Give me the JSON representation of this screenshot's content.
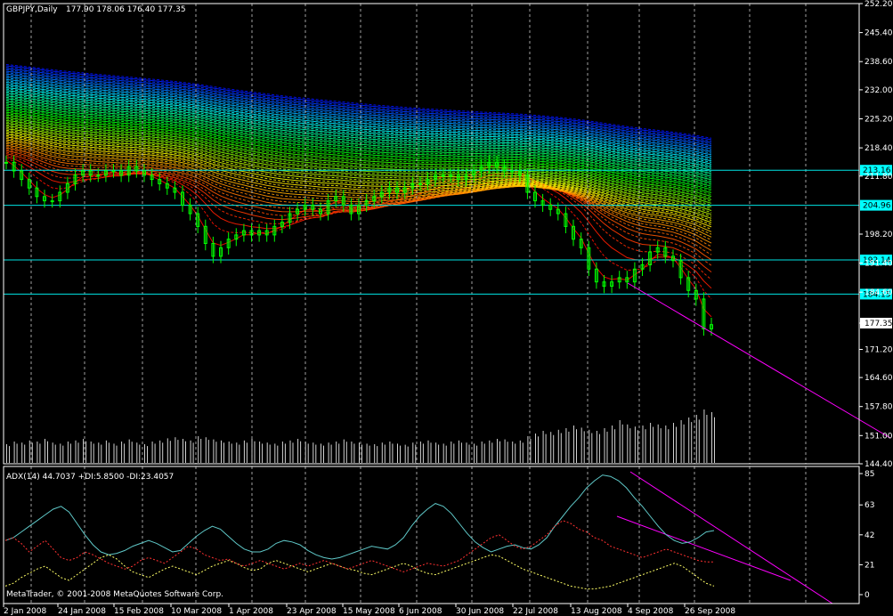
{
  "header": {
    "symbol": "GBPJPY,Daily",
    "ohlc": "177.90 178.06 176.40 177.35"
  },
  "indicator_header": {
    "text": "ADX(14) 44.7037 +DI:5.8500 -DI:23.4057"
  },
  "copyright": "MetaTrader, © 2001-2008 MetaQuotes Software Corp.",
  "colors": {
    "background": "#000000",
    "frame": "#ffffff",
    "grid": "#c8c8c8",
    "candle": "#00ff00",
    "hline": "#00e5e5",
    "trend": "#ff00ff",
    "adx": "#5fc8c8",
    "plus_di": "#ffff66",
    "minus_di": "#ff3030",
    "hline_label_bg": "#00ffff"
  },
  "chart_data": [
    {
      "type": "candlestick",
      "title": "GBPJPY,Daily",
      "x_ticks": [
        "2 Jan 2008",
        "24 Jan 2008",
        "15 Feb 2008",
        "10 Mar 2008",
        "1 Apr 2008",
        "23 Apr 2008",
        "15 May 2008",
        "6 Jun 2008",
        "30 Jun 2008",
        "22 Jul 2008",
        "13 Aug 2008",
        "4 Sep 2008",
        "26 Sep 2008"
      ],
      "y_ticks": [
        "252.20",
        "245.40",
        "238.60",
        "232.00",
        "225.20",
        "218.40",
        "211.80",
        "204.96",
        "198.20",
        "191.40",
        "184.60",
        "177.35",
        "171.20",
        "164.60",
        "157.80",
        "151.00",
        "144.40"
      ],
      "ylim": [
        144.4,
        252.2
      ],
      "last_price": "177.35",
      "horizontal_levels": [
        "213.16",
        "204.96",
        "192.14",
        "184.15"
      ],
      "series": [
        {
          "name": "close",
          "values": [
            215,
            213,
            211,
            209,
            207,
            206,
            206,
            208,
            210,
            212,
            213,
            212,
            212,
            213,
            213,
            212,
            214,
            213,
            212,
            211,
            210,
            209,
            208,
            205,
            203,
            200,
            196,
            193,
            195,
            197,
            198,
            199,
            198,
            199,
            198,
            200,
            201,
            203,
            204,
            205,
            204,
            203,
            206,
            207,
            205,
            203,
            205,
            206,
            207,
            208,
            209,
            208,
            209,
            210,
            210,
            211,
            212,
            212,
            212,
            211,
            212,
            213,
            214,
            215,
            214,
            213,
            213,
            212,
            208,
            206,
            205,
            204,
            203,
            200,
            197,
            195,
            190,
            187,
            186,
            187,
            188,
            187,
            190,
            191,
            194,
            195,
            193,
            192,
            188,
            185,
            183,
            176,
            177
          ]
        },
        {
          "name": "volume",
          "values": [
            0.35,
            0.4,
            0.38,
            0.42,
            0.4,
            0.45,
            0.38,
            0.36,
            0.4,
            0.42,
            0.45,
            0.4,
            0.38,
            0.42,
            0.36,
            0.4,
            0.44,
            0.38,
            0.35,
            0.4,
            0.42,
            0.46,
            0.48,
            0.45,
            0.42,
            0.5,
            0.48,
            0.44,
            0.42,
            0.4,
            0.38,
            0.42,
            0.45,
            0.4,
            0.38,
            0.36,
            0.4,
            0.42,
            0.45,
            0.4,
            0.38,
            0.36,
            0.38,
            0.4,
            0.44,
            0.4,
            0.38,
            0.36,
            0.35,
            0.38,
            0.4,
            0.36,
            0.34,
            0.38,
            0.4,
            0.42,
            0.38,
            0.36,
            0.4,
            0.42,
            0.38,
            0.36,
            0.4,
            0.42,
            0.45,
            0.44,
            0.4,
            0.42,
            0.5,
            0.55,
            0.6,
            0.58,
            0.62,
            0.65,
            0.7,
            0.66,
            0.62,
            0.6,
            0.65,
            0.7,
            0.8,
            0.72,
            0.68,
            0.7,
            0.75,
            0.72,
            0.7,
            0.75,
            0.8,
            0.85,
            0.9,
            1.0,
            0.95
          ]
        }
      ]
    },
    {
      "type": "line",
      "title": "ADX(14) 44.7037 +DI:5.8500 -DI:23.4057",
      "y_ticks": [
        "85",
        "63",
        "42",
        "21",
        "0"
      ],
      "ylim": [
        0,
        85
      ],
      "series": [
        {
          "name": "ADX",
          "values": [
            38,
            40,
            44,
            48,
            52,
            56,
            60,
            62,
            58,
            50,
            42,
            35,
            30,
            28,
            29,
            31,
            34,
            36,
            38,
            36,
            33,
            30,
            31,
            36,
            41,
            45,
            48,
            46,
            41,
            36,
            32,
            30,
            30,
            32,
            36,
            38,
            37,
            35,
            31,
            28,
            26,
            25,
            26,
            28,
            30,
            32,
            34,
            33,
            32,
            35,
            40,
            48,
            55,
            60,
            64,
            62,
            57,
            50,
            43,
            37,
            33,
            30,
            32,
            34,
            35,
            33,
            32,
            35,
            40,
            48,
            55,
            62,
            68,
            75,
            80,
            84,
            83,
            80,
            75,
            68,
            62,
            55,
            48,
            42,
            38,
            36,
            37,
            40,
            44,
            45
          ]
        },
        {
          "name": "+DI",
          "values": [
            6,
            8,
            12,
            15,
            18,
            20,
            16,
            12,
            10,
            14,
            18,
            22,
            26,
            28,
            25,
            20,
            16,
            14,
            12,
            15,
            18,
            20,
            18,
            16,
            14,
            17,
            20,
            22,
            24,
            22,
            19,
            17,
            18,
            22,
            24,
            22,
            20,
            18,
            16,
            18,
            20,
            22,
            20,
            18,
            17,
            15,
            14,
            16,
            18,
            20,
            22,
            20,
            17,
            15,
            14,
            16,
            18,
            20,
            22,
            24,
            26,
            28,
            27,
            24,
            21,
            18,
            16,
            14,
            12,
            10,
            8,
            6,
            5,
            4,
            4,
            5,
            6,
            8,
            10,
            12,
            14,
            16,
            18,
            20,
            22,
            20,
            16,
            12,
            8,
            6
          ]
        },
        {
          "name": "-DI",
          "values": [
            38,
            40,
            36,
            30,
            34,
            38,
            32,
            26,
            24,
            26,
            30,
            28,
            25,
            22,
            20,
            18,
            20,
            24,
            26,
            24,
            22,
            26,
            30,
            34,
            32,
            28,
            26,
            24,
            25,
            22,
            20,
            22,
            24,
            22,
            20,
            18,
            20,
            22,
            20,
            22,
            24,
            22,
            20,
            18,
            20,
            22,
            24,
            22,
            20,
            18,
            16,
            18,
            20,
            22,
            21,
            20,
            22,
            24,
            28,
            32,
            36,
            40,
            42,
            38,
            34,
            32,
            34,
            38,
            42,
            48,
            52,
            50,
            46,
            44,
            40,
            38,
            34,
            32,
            30,
            28,
            26,
            28,
            30,
            32,
            30,
            28,
            26,
            24,
            23,
            23
          ]
        }
      ]
    }
  ]
}
